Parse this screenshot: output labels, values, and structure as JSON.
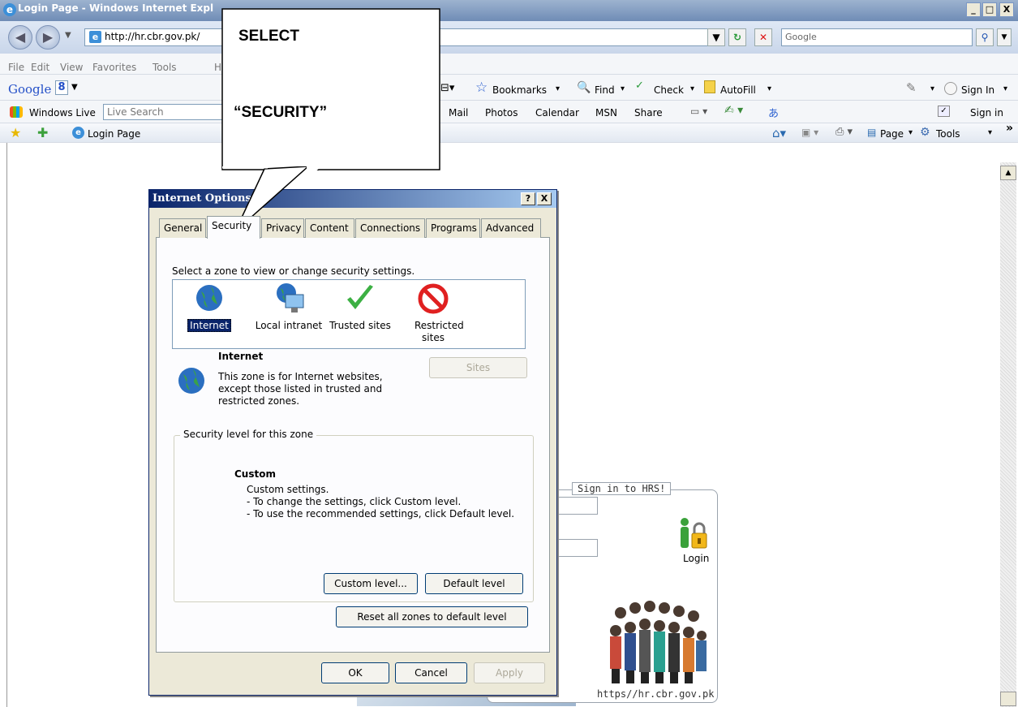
{
  "window": {
    "title": "Login Page - Windows Internet Expl",
    "min": "_",
    "max": "□",
    "close": "X"
  },
  "address": {
    "url": "http://hr.cbr.gov.pk/",
    "search_placeholder": "Google"
  },
  "menu": [
    "File",
    "Edit",
    "View",
    "Favorites",
    "Tools",
    "H"
  ],
  "google_bar": {
    "brand": "Google",
    "g8": "8",
    "bookmarks": "Bookmarks",
    "find": "Find",
    "check": "Check",
    "autofill": "AutoFill",
    "sign_in": "Sign In"
  },
  "live_bar": {
    "brand": "Windows Live",
    "search_placeholder": "Live Search",
    "mail": "Mail",
    "photos": "Photos",
    "calendar": "Calendar",
    "msn": "MSN",
    "share": "Share",
    "sign_in": "Sign in"
  },
  "fav_bar": {
    "tab_title": "Login Page",
    "page": "Page",
    "tools": "Tools",
    "more": "»"
  },
  "callout": {
    "line1": "SELECT",
    "line2": "“SECURITY”"
  },
  "dialog": {
    "title": "Internet Options",
    "help": "?",
    "close": "X",
    "tabs": [
      "General",
      "Security",
      "Privacy",
      "Content",
      "Connections",
      "Programs",
      "Advanced"
    ],
    "zone_prompt": "Select a zone to view or change security settings.",
    "zones": [
      {
        "label": "Internet",
        "icon": "globe-icon"
      },
      {
        "label": "Local intranet",
        "icon": "intranet-icon"
      },
      {
        "label": "Trusted sites",
        "icon": "checkmark-icon"
      },
      {
        "label": "Restricted sites",
        "icon": "prohibited-icon"
      }
    ],
    "selected_zone": {
      "name": "Internet",
      "description": "This zone is for Internet websites, except those listed in trusted and restricted zones."
    },
    "sites_button": "Sites",
    "security_group_label": "Security level for this zone",
    "level": {
      "title": "Custom",
      "line1": "Custom settings.",
      "line2": "- To change the settings, click Custom level.",
      "line3": "- To use the recommended settings, click Default level."
    },
    "custom_level_button": "Custom level...",
    "default_level_button": "Default level",
    "reset_button": "Reset all zones to default level",
    "ok_button": "OK",
    "cancel_button": "Cancel",
    "apply_button": "Apply"
  },
  "login": {
    "legend": "Sign in to HRS!",
    "login_label": "Login",
    "url": "https//hr.cbr.gov.pk"
  }
}
